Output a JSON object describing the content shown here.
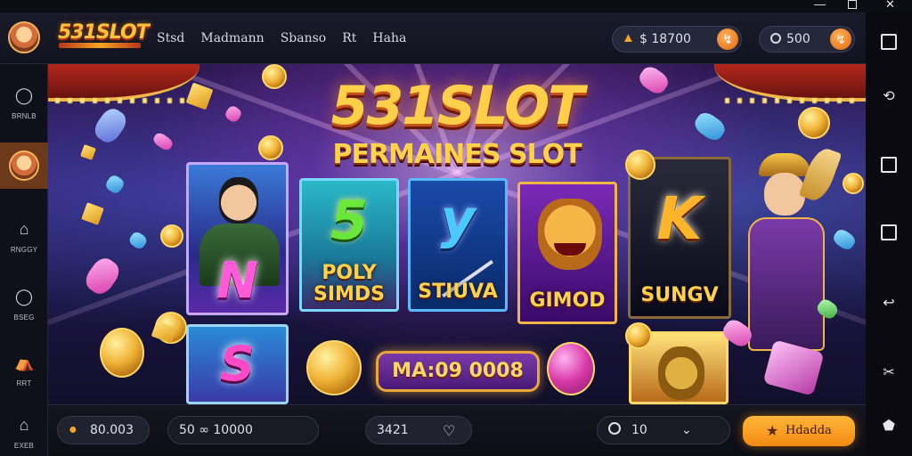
{
  "header": {
    "logo": "531SLOT",
    "nav": [
      "Stsd",
      "Madmann",
      "Sbanso",
      "Rt",
      "Haha"
    ],
    "balance_1": "$ 18700",
    "balance_2": "500"
  },
  "sidebar": {
    "items": [
      {
        "label": "BRNLB",
        "icon": "chat-icon"
      },
      {
        "label": "",
        "icon": "character-avatar"
      },
      {
        "label": "RNGGY",
        "icon": "home-icon"
      },
      {
        "label": "BSEG",
        "icon": "chat-icon"
      },
      {
        "label": "RRT",
        "icon": "tent-icon"
      },
      {
        "label": "EXEB",
        "icon": "home-icon"
      }
    ]
  },
  "hero": {
    "title": "531SLOT",
    "subtitle": "PERMAINES SLOT",
    "cards": [
      {
        "big": "N",
        "caption": ""
      },
      {
        "big": "5",
        "caption": "POLY SIMDS"
      },
      {
        "big": "y",
        "caption": "STIUVA"
      },
      {
        "big": "",
        "caption": "GIMOD"
      },
      {
        "big": "K",
        "caption": "SUNGV"
      },
      {
        "big": "S",
        "caption": ""
      }
    ],
    "promo": "MA:09 0008"
  },
  "bottombar": {
    "credit": "80.003",
    "bet": "50 ∞ 10000",
    "stake": "3421",
    "search_value": "10",
    "play_label": "Hdadda"
  },
  "colors": {
    "accent": "#f5a623",
    "title_gold": "#ffcf4a",
    "bg": "#0a0a12"
  }
}
